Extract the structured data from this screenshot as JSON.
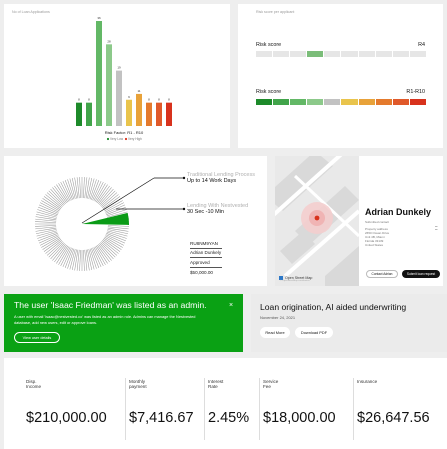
{
  "loan_chart": {
    "title": "No of Loan Applications",
    "legend_label": "Risk Factor: R1 - R10",
    "legend_low": "Very Low",
    "legend_high": "Very High"
  },
  "chart_data": {
    "type": "bar",
    "categories": [
      "R1",
      "R2",
      "R3",
      "R4",
      "R5",
      "R6",
      "R7",
      "R8",
      "R9",
      "R10"
    ],
    "values": [
      8,
      8,
      36,
      28,
      19,
      9,
      11,
      8,
      8,
      8
    ],
    "value_labels": [
      "8",
      "8",
      "36",
      "28",
      "19",
      "9",
      "11",
      "8",
      "8",
      "8"
    ],
    "colors": [
      "#1d8a2a",
      "#41a44a",
      "#63b866",
      "#8cc98a",
      "#c2c2c2",
      "#e9c44c",
      "#e8a23a",
      "#e47a2d",
      "#e0592a",
      "#d8321d"
    ],
    "xlabel": "Risk Factor: R1 - R10",
    "ylabel": "",
    "ylim": [
      0,
      36
    ]
  },
  "risk_card": {
    "title": "Risk score per applicant",
    "row1": {
      "label": "Risk score",
      "value": "R4",
      "active_index": 3
    },
    "row2": {
      "label": "Risk score",
      "value": "R1-R10"
    },
    "segment_colors": [
      "#1d8a2a",
      "#41a44a",
      "#63b866",
      "#8cc98a",
      "#c2c2c2",
      "#e9c44c",
      "#e8a23a",
      "#e47a2d",
      "#e0592a",
      "#d8321d"
    ],
    "inactive_color": "#e6e6e6",
    "active_color": "#7bbd79"
  },
  "process": {
    "traditional_label": "Traditional Lending Process",
    "traditional_value": "Up to 14 Work Days",
    "nest_label": "Lending With Nestvested",
    "nest_value": "30 Sec -10 Min",
    "mini_id": "RU8NM9YAN",
    "mini_name": "Adrian Dunkely",
    "mini_status": "Approved",
    "mini_amount": "$50,000.00"
  },
  "profile": {
    "name": "Adrian Dunkely",
    "lines": [
      "Submitted contact",
      "Property address",
      "2650 Ocean Drive",
      "Unit 4B, Miami",
      "Florida 33139",
      "United States"
    ],
    "contact_button": "Contact Adrian",
    "submit_button": "Submit loan request",
    "map_link": "Open Street Map",
    "map_copyright": "© OpenStreetMap contributors"
  },
  "toast": {
    "title": "The user 'Isaac Friedman' was listed as an admin.",
    "body": "A user with email 'isaac@nestvested.co' was listed as an admin role. Admins can manage the Nestvested database, add new users, edit or approve loans.",
    "button": "View user details",
    "bg": "#0aa114"
  },
  "article": {
    "title": "Loan origination, AI aided underwriting",
    "date": "November 24, 2021",
    "read_more": "Read More",
    "download": "Download PDF"
  },
  "metrics": [
    {
      "label": "Disp. Income",
      "value": "$210,000.00"
    },
    {
      "label": "Monthly payment",
      "value": "$7,416.67"
    },
    {
      "label": "Interest Rate",
      "value": "2.45%"
    },
    {
      "label": "Service Fee",
      "value": "$18,000.00"
    },
    {
      "label": "Insurance",
      "value": "$26,647.56"
    }
  ]
}
